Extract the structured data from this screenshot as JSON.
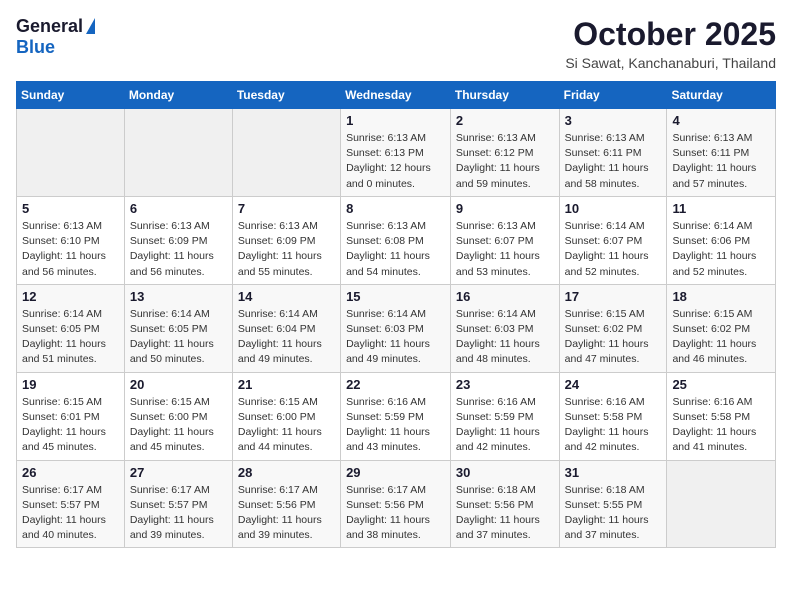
{
  "logo": {
    "general": "General",
    "blue": "Blue"
  },
  "header": {
    "title": "October 2025",
    "subtitle": "Si Sawat, Kanchanaburi, Thailand"
  },
  "weekdays": [
    "Sunday",
    "Monday",
    "Tuesday",
    "Wednesday",
    "Thursday",
    "Friday",
    "Saturday"
  ],
  "weeks": [
    [
      {
        "day": "",
        "info": ""
      },
      {
        "day": "",
        "info": ""
      },
      {
        "day": "",
        "info": ""
      },
      {
        "day": "1",
        "info": "Sunrise: 6:13 AM\nSunset: 6:13 PM\nDaylight: 12 hours\nand 0 minutes."
      },
      {
        "day": "2",
        "info": "Sunrise: 6:13 AM\nSunset: 6:12 PM\nDaylight: 11 hours\nand 59 minutes."
      },
      {
        "day": "3",
        "info": "Sunrise: 6:13 AM\nSunset: 6:11 PM\nDaylight: 11 hours\nand 58 minutes."
      },
      {
        "day": "4",
        "info": "Sunrise: 6:13 AM\nSunset: 6:11 PM\nDaylight: 11 hours\nand 57 minutes."
      }
    ],
    [
      {
        "day": "5",
        "info": "Sunrise: 6:13 AM\nSunset: 6:10 PM\nDaylight: 11 hours\nand 56 minutes."
      },
      {
        "day": "6",
        "info": "Sunrise: 6:13 AM\nSunset: 6:09 PM\nDaylight: 11 hours\nand 56 minutes."
      },
      {
        "day": "7",
        "info": "Sunrise: 6:13 AM\nSunset: 6:09 PM\nDaylight: 11 hours\nand 55 minutes."
      },
      {
        "day": "8",
        "info": "Sunrise: 6:13 AM\nSunset: 6:08 PM\nDaylight: 11 hours\nand 54 minutes."
      },
      {
        "day": "9",
        "info": "Sunrise: 6:13 AM\nSunset: 6:07 PM\nDaylight: 11 hours\nand 53 minutes."
      },
      {
        "day": "10",
        "info": "Sunrise: 6:14 AM\nSunset: 6:07 PM\nDaylight: 11 hours\nand 52 minutes."
      },
      {
        "day": "11",
        "info": "Sunrise: 6:14 AM\nSunset: 6:06 PM\nDaylight: 11 hours\nand 52 minutes."
      }
    ],
    [
      {
        "day": "12",
        "info": "Sunrise: 6:14 AM\nSunset: 6:05 PM\nDaylight: 11 hours\nand 51 minutes."
      },
      {
        "day": "13",
        "info": "Sunrise: 6:14 AM\nSunset: 6:05 PM\nDaylight: 11 hours\nand 50 minutes."
      },
      {
        "day": "14",
        "info": "Sunrise: 6:14 AM\nSunset: 6:04 PM\nDaylight: 11 hours\nand 49 minutes."
      },
      {
        "day": "15",
        "info": "Sunrise: 6:14 AM\nSunset: 6:03 PM\nDaylight: 11 hours\nand 49 minutes."
      },
      {
        "day": "16",
        "info": "Sunrise: 6:14 AM\nSunset: 6:03 PM\nDaylight: 11 hours\nand 48 minutes."
      },
      {
        "day": "17",
        "info": "Sunrise: 6:15 AM\nSunset: 6:02 PM\nDaylight: 11 hours\nand 47 minutes."
      },
      {
        "day": "18",
        "info": "Sunrise: 6:15 AM\nSunset: 6:02 PM\nDaylight: 11 hours\nand 46 minutes."
      }
    ],
    [
      {
        "day": "19",
        "info": "Sunrise: 6:15 AM\nSunset: 6:01 PM\nDaylight: 11 hours\nand 45 minutes."
      },
      {
        "day": "20",
        "info": "Sunrise: 6:15 AM\nSunset: 6:00 PM\nDaylight: 11 hours\nand 45 minutes."
      },
      {
        "day": "21",
        "info": "Sunrise: 6:15 AM\nSunset: 6:00 PM\nDaylight: 11 hours\nand 44 minutes."
      },
      {
        "day": "22",
        "info": "Sunrise: 6:16 AM\nSunset: 5:59 PM\nDaylight: 11 hours\nand 43 minutes."
      },
      {
        "day": "23",
        "info": "Sunrise: 6:16 AM\nSunset: 5:59 PM\nDaylight: 11 hours\nand 42 minutes."
      },
      {
        "day": "24",
        "info": "Sunrise: 6:16 AM\nSunset: 5:58 PM\nDaylight: 11 hours\nand 42 minutes."
      },
      {
        "day": "25",
        "info": "Sunrise: 6:16 AM\nSunset: 5:58 PM\nDaylight: 11 hours\nand 41 minutes."
      }
    ],
    [
      {
        "day": "26",
        "info": "Sunrise: 6:17 AM\nSunset: 5:57 PM\nDaylight: 11 hours\nand 40 minutes."
      },
      {
        "day": "27",
        "info": "Sunrise: 6:17 AM\nSunset: 5:57 PM\nDaylight: 11 hours\nand 39 minutes."
      },
      {
        "day": "28",
        "info": "Sunrise: 6:17 AM\nSunset: 5:56 PM\nDaylight: 11 hours\nand 39 minutes."
      },
      {
        "day": "29",
        "info": "Sunrise: 6:17 AM\nSunset: 5:56 PM\nDaylight: 11 hours\nand 38 minutes."
      },
      {
        "day": "30",
        "info": "Sunrise: 6:18 AM\nSunset: 5:56 PM\nDaylight: 11 hours\nand 37 minutes."
      },
      {
        "day": "31",
        "info": "Sunrise: 6:18 AM\nSunset: 5:55 PM\nDaylight: 11 hours\nand 37 minutes."
      },
      {
        "day": "",
        "info": ""
      }
    ]
  ]
}
